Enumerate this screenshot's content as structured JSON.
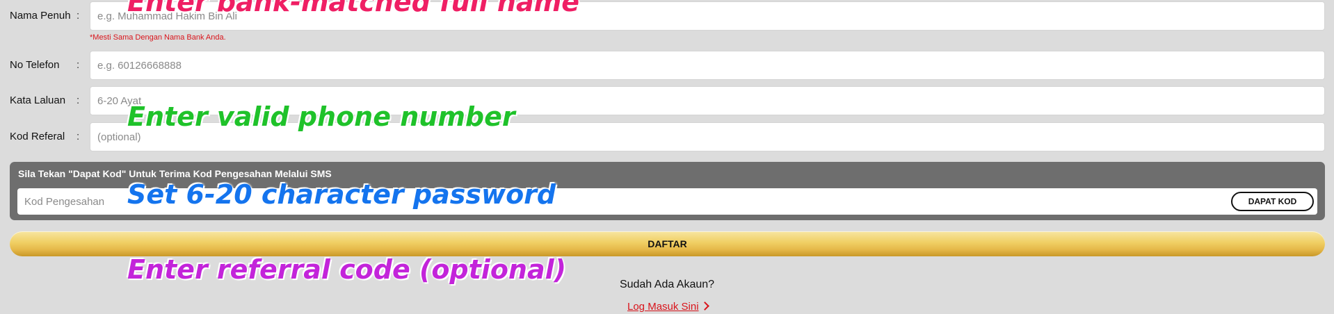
{
  "colors": {
    "page_background": "#dcdcdc",
    "panel_background": "#6e6e6e",
    "button_gold": "#f0cf63",
    "warning_red": "#d9141b",
    "annotation_pink": "#ef1f64",
    "annotation_green": "#1fc22a",
    "annotation_blue": "#1474ee",
    "annotation_purple": "#c324da"
  },
  "form": {
    "full_name": {
      "label": "Nama Penuh",
      "colon": ":",
      "placeholder": "e.g. Muhammad Hakim Bin Ali",
      "note": "*Mesti Sama Dengan Nama Bank Anda."
    },
    "phone": {
      "label": "No Telefon",
      "colon": ":",
      "placeholder": "e.g. 60126668888"
    },
    "password": {
      "label": "Kata Laluan",
      "colon": ":",
      "placeholder": "6-20 Ayat"
    },
    "referral": {
      "label": "Kod Referal",
      "colon": ":",
      "placeholder": "(optional)"
    }
  },
  "otp": {
    "instruction": "Sila Tekan \"Dapat Kod\" Untuk Terima Kod Pengesahan Melalui SMS",
    "placeholder": "Kod Pengesahan",
    "button_label": "DAPAT KOD"
  },
  "submit": {
    "label": "DAFTAR"
  },
  "login": {
    "question": "Sudah Ada Akaun?",
    "link_label": "Log Masuk Sini",
    "link_icon": "chevron-right-icon"
  },
  "annotations": {
    "name": "Enter bank-matched full name",
    "phone": "Enter valid phone number",
    "password": "Set 6-20 character password",
    "referral": "Enter referral code (optional)"
  }
}
